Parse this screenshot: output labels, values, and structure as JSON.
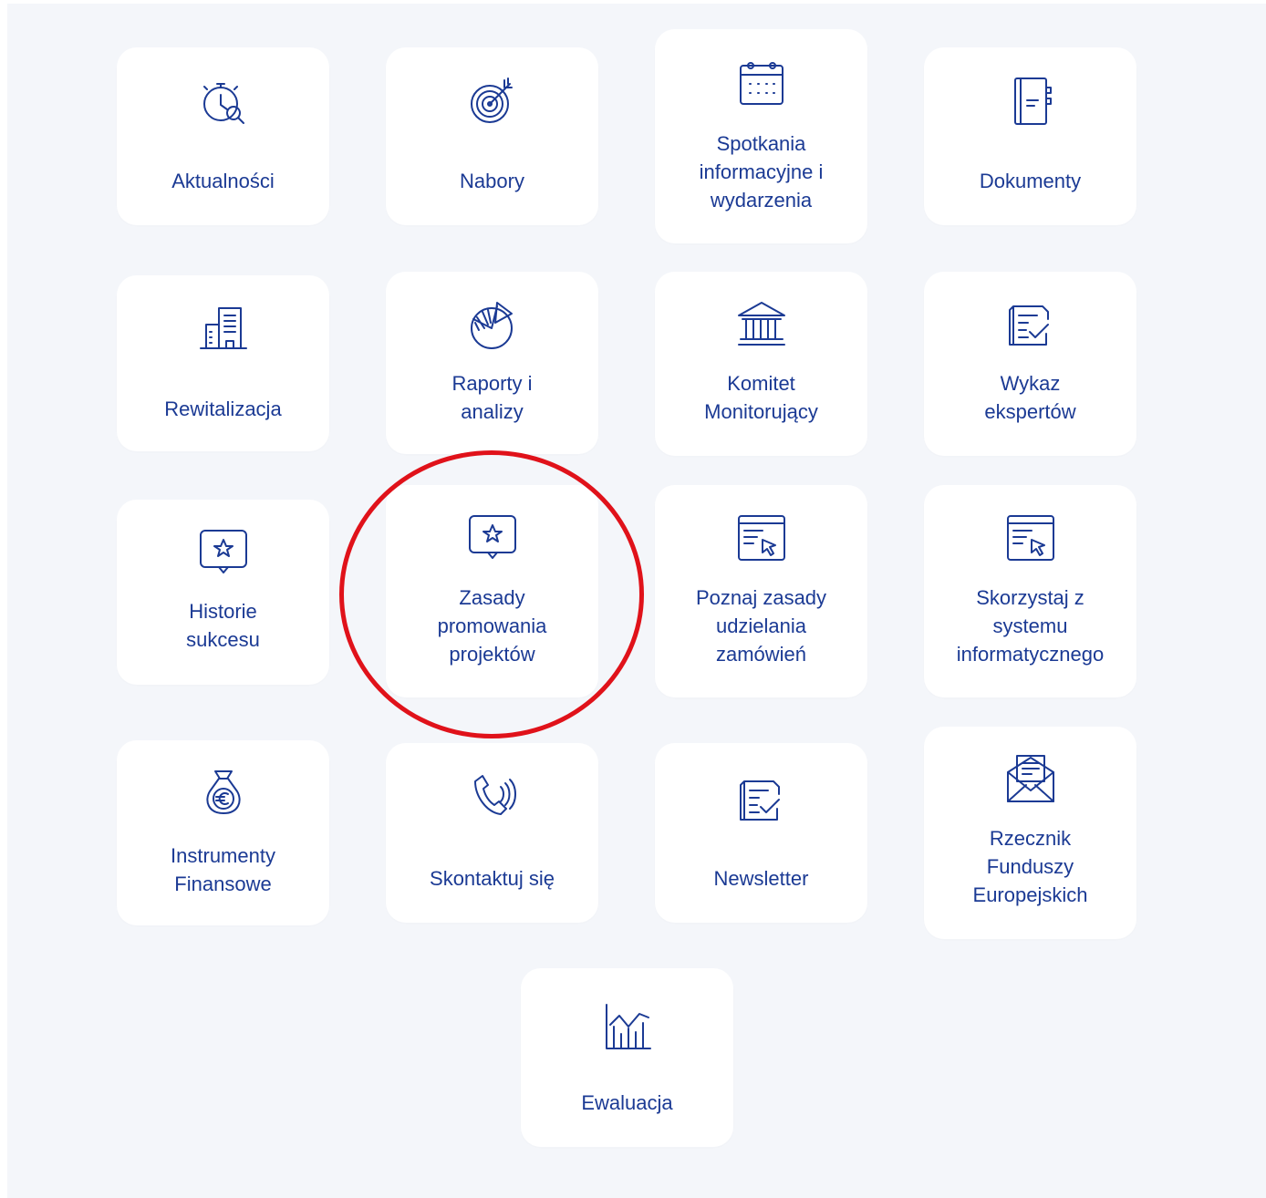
{
  "tiles": [
    {
      "label": "Aktualności",
      "icon": "stopwatch-search-icon"
    },
    {
      "label": "Nabory",
      "icon": "target-icon"
    },
    {
      "label": "Spotkania\ninformacyjne i\nwydarzenia",
      "icon": "calendar-icon"
    },
    {
      "label": "Dokumenty",
      "icon": "notebook-icon"
    },
    {
      "label": "Rewitalizacja",
      "icon": "buildings-icon"
    },
    {
      "label": "Raporty i\nanalizy",
      "icon": "pie-chart-icon"
    },
    {
      "label": "Komitet\nMonitorujący",
      "icon": "institution-icon"
    },
    {
      "label": "Wykaz\nekspertów",
      "icon": "checklist-icon"
    },
    {
      "label": "Historie\nsukcesu",
      "icon": "star-badge-icon"
    },
    {
      "label": "Zasady\npromowania\nprojektów",
      "icon": "star-badge-icon"
    },
    {
      "label": "Poznaj zasady\nudzielania\nzamówień",
      "icon": "browser-cursor-icon"
    },
    {
      "label": "Skorzystaj z\nsystemu\ninformatycznego",
      "icon": "browser-cursor-icon"
    },
    {
      "label": "Instrumenty\nFinansowe",
      "icon": "euro-bag-icon"
    },
    {
      "label": "Skontaktuj się",
      "icon": "phone-call-icon"
    },
    {
      "label": "Newsletter",
      "icon": "checklist-icon"
    },
    {
      "label": "Rzecznik\nFunduszy\nEuropejskich",
      "icon": "envelope-letter-icon"
    },
    {
      "label": "Ewaluacja",
      "icon": "bar-chart-icon"
    }
  ],
  "colors": {
    "text": "#1b3a94",
    "highlight": "#e0121a",
    "background": "#f4f6fa",
    "tile": "#ffffff"
  },
  "highlighted_tile": "Zasady\npromowania\nprojektów"
}
